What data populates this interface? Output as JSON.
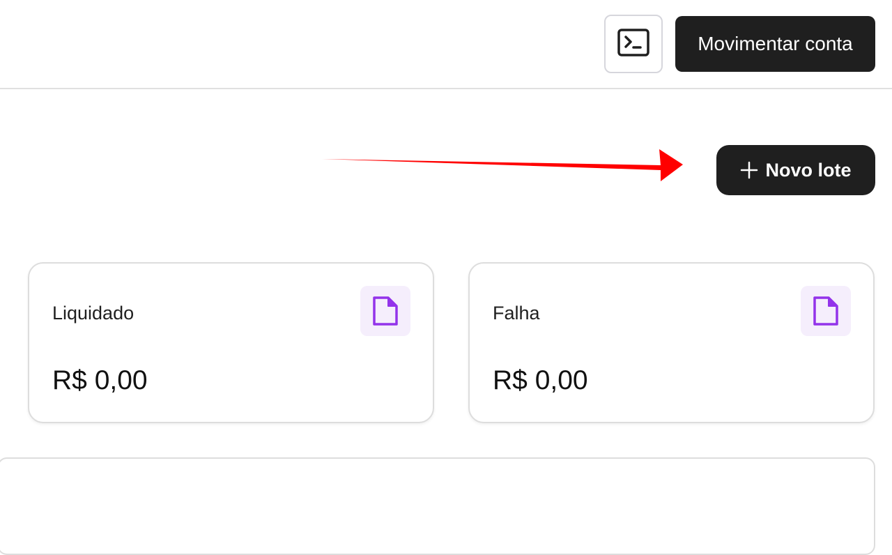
{
  "header": {
    "terminal_icon": "terminal-icon",
    "move_account_label": "Movimentar conta"
  },
  "actions": {
    "new_batch_label": "Novo lote",
    "plus_icon": "plus-icon"
  },
  "annotation": {
    "arrow_color": "#ff0000"
  },
  "cards": [
    {
      "label": "Liquidado",
      "value": "R$ 0,00",
      "icon": "file-icon"
    },
    {
      "label": "Falha",
      "value": "R$ 0,00",
      "icon": "file-icon"
    }
  ],
  "colors": {
    "primary_button": "#1f1f1f",
    "icon_accent": "#9333ea",
    "icon_bg": "#f5eefc"
  }
}
